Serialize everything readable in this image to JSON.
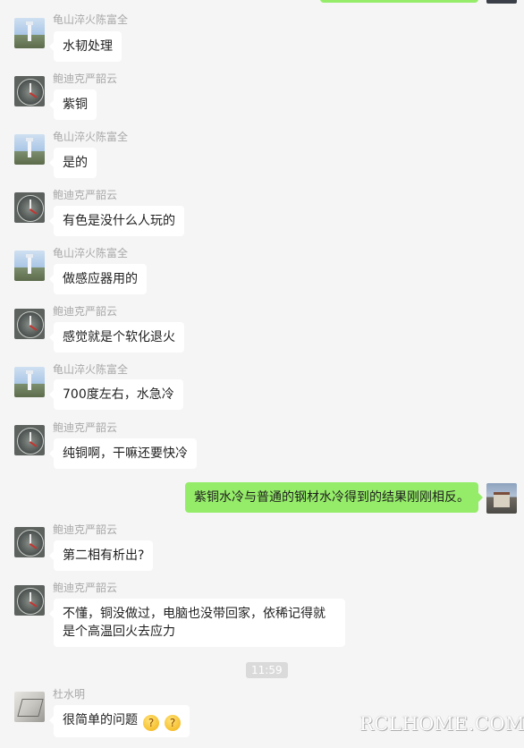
{
  "messages": [
    {
      "sender": "龟山淬火陈富全",
      "text": "水韧处理"
    },
    {
      "sender": "鲍迪克严韶云",
      "text": "紫铜"
    },
    {
      "sender": "龟山淬火陈富全",
      "text": "是的"
    },
    {
      "sender": "鲍迪克严韶云",
      "text": "有色是没什么人玩的"
    },
    {
      "sender": "龟山淬火陈富全",
      "text": "做感应器用的"
    },
    {
      "sender": "鲍迪克严韶云",
      "text": "感觉就是个软化退火"
    },
    {
      "sender": "龟山淬火陈富全",
      "text": "700度左右，水急冷"
    },
    {
      "sender": "鲍迪克严韶云",
      "text": "纯铜啊，干嘛还要快冷"
    },
    {
      "sender": "",
      "text": "紫铜水冷与普通的钢材水冷得到的结果刚刚相反。"
    },
    {
      "sender": "鲍迪克严韶云",
      "text": "第二相有析出?"
    },
    {
      "sender": "鲍迪克严韶云",
      "text": "不懂，铜没做过，电脑也没带回家，依稀记得就是个高温回火去应力"
    },
    {
      "sender": "杜水明",
      "text": "很简单的问题"
    }
  ],
  "timestamp": "11:59",
  "watermark": "RCLHOME.COM",
  "colors": {
    "background": "#f5f5f5",
    "bubble_other": "#ffffff",
    "bubble_self": "#95ec69",
    "name_text": "#a8a8a8"
  },
  "icons": {
    "last_message_emoji": "thinking-face-icon"
  }
}
